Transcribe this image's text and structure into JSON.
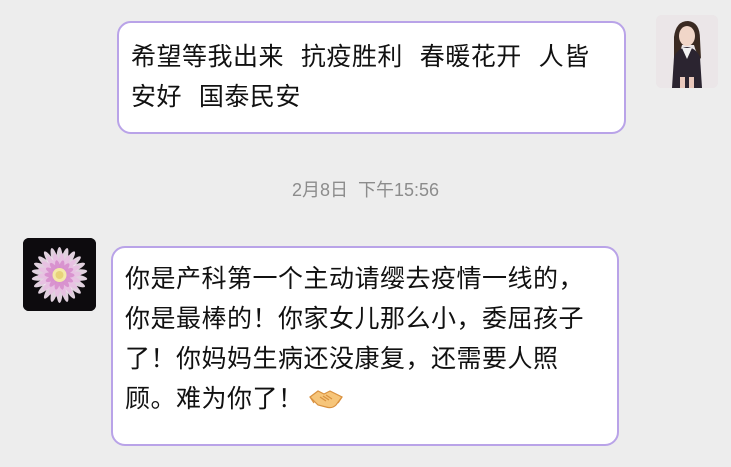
{
  "chat": {
    "messages": [
      {
        "side": "outgoing",
        "text": "希望等我出来  抗疫胜利  春暖花开  人皆安好  国泰民安",
        "avatar": "avatar-girl-portrait"
      },
      {
        "side": "incoming",
        "text": "你是产科第一个主动请缨去疫情一线的，你是最棒的！你家女儿那么小，委屈孩子了！你妈妈生病还没康复，还需要人照顾。难为你了！",
        "emoji": "handshake-icon",
        "avatar": "avatar-dahlia-flower"
      }
    ],
    "timestamp": {
      "date": "2月8日",
      "time": "下午15:56"
    }
  },
  "colors": {
    "background": "#ededed",
    "bubble_border": "#b9a3e8",
    "bubble_fill": "#ffffff",
    "timestamp_text": "#8c8c8c"
  }
}
